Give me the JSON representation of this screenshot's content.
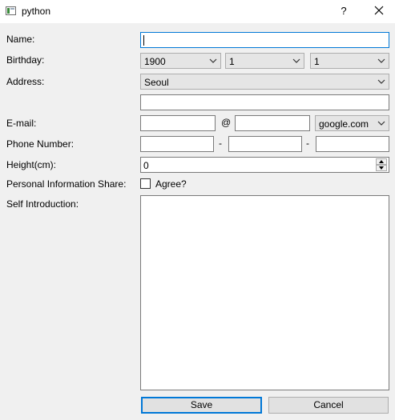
{
  "window": {
    "title": "python",
    "help_label": "?"
  },
  "form": {
    "name": {
      "label": "Name:",
      "value": ""
    },
    "birthday": {
      "label": "Birthday:",
      "year": "1900",
      "month": "1",
      "day": "1"
    },
    "address": {
      "label": "Address:",
      "city": "Seoul",
      "detail": ""
    },
    "email": {
      "label": "E-mail:",
      "local": "",
      "at": "@",
      "domain_text": "",
      "domain_select": "google.com"
    },
    "phone": {
      "label": "Phone Number:",
      "part1": "",
      "dash1": "-",
      "part2": "",
      "dash2": "-",
      "part3": ""
    },
    "height": {
      "label": "Height(cm):",
      "value": "0"
    },
    "personal_info": {
      "label": "Personal Information Share:",
      "checkbox_label": "Agree?",
      "checked": false
    },
    "self_intro": {
      "label": "Self Introduction:",
      "value": ""
    }
  },
  "buttons": {
    "save": "Save",
    "cancel": "Cancel"
  }
}
